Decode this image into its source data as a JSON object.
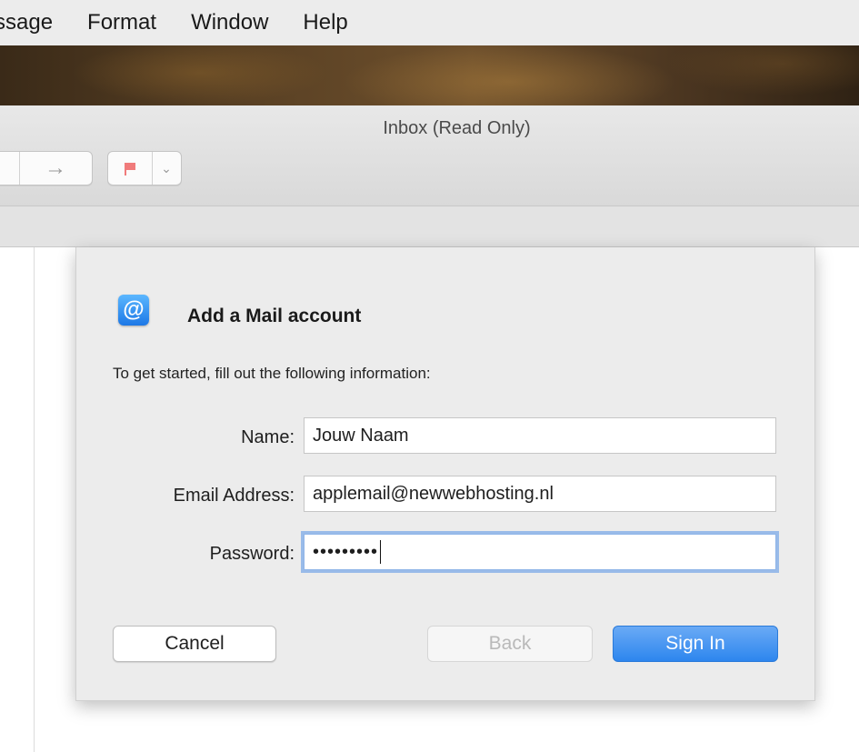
{
  "menubar": {
    "items": [
      "ssage",
      "Format",
      "Window",
      "Help"
    ]
  },
  "window": {
    "title": "Inbox (Read Only)"
  },
  "toolbar": {
    "forward_icon": "arrow-right-icon",
    "flag_icon": "flag-icon",
    "flag_color": "#f07b7b",
    "chevron_icon": "chevron-down-icon"
  },
  "dialog": {
    "icon": "at-sign-icon",
    "icon_glyph": "@",
    "title": "Add a Mail account",
    "subtitle": "To get started, fill out the following information:",
    "fields": {
      "name": {
        "label": "Name:",
        "value": "Jouw Naam"
      },
      "email": {
        "label": "Email Address:",
        "value": "applemail@newwebhosting.nl"
      },
      "password": {
        "label": "Password:",
        "value_masked": "•••••••••"
      }
    },
    "buttons": {
      "cancel": "Cancel",
      "back": "Back",
      "sign_in": "Sign In"
    },
    "accent_color": "#2d86ee"
  }
}
